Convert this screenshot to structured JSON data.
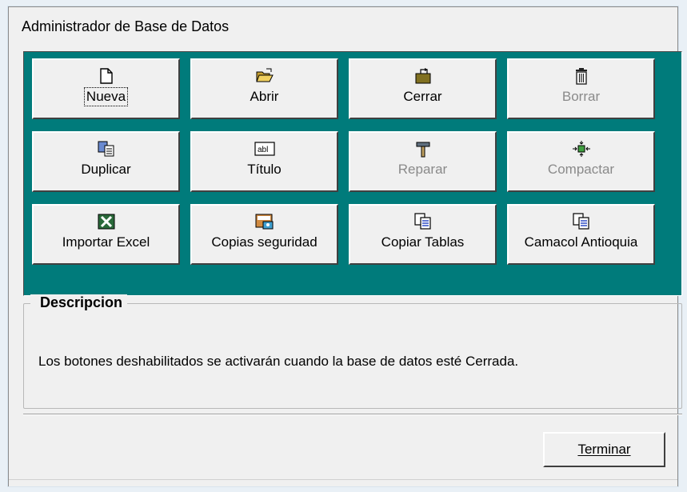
{
  "window": {
    "title": "Administrador de Base de Datos"
  },
  "buttons": [
    {
      "label": "Nueva",
      "icon": "new-document-icon",
      "enabled": true,
      "focused": true
    },
    {
      "label": "Abrir",
      "icon": "open-folder-icon",
      "enabled": true
    },
    {
      "label": "Cerrar",
      "icon": "close-folder-icon",
      "enabled": true
    },
    {
      "label": "Borrar",
      "icon": "trash-icon",
      "enabled": false
    },
    {
      "label": "Duplicar",
      "icon": "duplicate-icon",
      "enabled": true
    },
    {
      "label": "Título",
      "icon": "title-field-icon",
      "enabled": true
    },
    {
      "label": "Reparar",
      "icon": "hammer-icon",
      "enabled": false
    },
    {
      "label": "Compactar",
      "icon": "compact-icon",
      "enabled": false
    },
    {
      "label": "Importar Excel",
      "icon": "excel-icon",
      "enabled": true
    },
    {
      "label": "Copias seguridad",
      "icon": "backup-icon",
      "enabled": true
    },
    {
      "label": "Copiar Tablas",
      "icon": "copy-tables-icon",
      "enabled": true
    },
    {
      "label": "Camacol Antioquia",
      "icon": "copy-tables-icon",
      "enabled": true
    }
  ],
  "description": {
    "title": "Descripcion",
    "text": "Los botones deshabilitados se activarán cuando la base de datos esté Cerrada."
  },
  "footer": {
    "terminar_label": "Terminar"
  },
  "colors": {
    "panel": "#007b7b",
    "window_bg": "#f0f0f0",
    "disabled_text": "#8a8a8a"
  }
}
